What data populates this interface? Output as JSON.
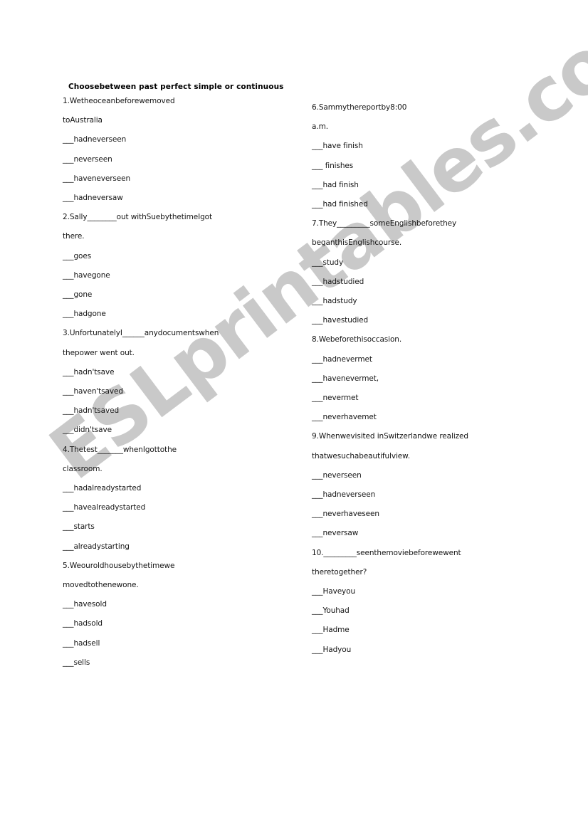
{
  "document": {
    "type": "esl-worksheet",
    "title": "Choosebetween past perfect simple or continuous",
    "watermark": "ESLprintables.com",
    "watermark_color": "#c9c9c9",
    "text_color": "#151515",
    "page_background": "#ffffff"
  },
  "left_column": [
    {
      "number": "1.",
      "stem_lines": [
        "1.Wetheoceanbeforewemoved",
        "toAustralia"
      ],
      "options": [
        "___hadneverseen",
        "___neverseen",
        "___haveneverseen",
        "___hadneversaw"
      ]
    },
    {
      "number": "2.",
      "stem_lines": [
        "2.Sally________out withSuebythetimeIgot",
        "there."
      ],
      "options": [
        "___goes",
        "___havegone",
        "___gone",
        "___hadgone"
      ]
    },
    {
      "number": "3.",
      "stem_lines": [
        "3.UnfortunatelyI______anydocumentswhen",
        "thepower went out."
      ],
      "options": [
        "___hadn'tsave",
        "___haven'tsaved",
        "___hadn'tsaved",
        "___didn'tsave"
      ]
    },
    {
      "number": "4.",
      "stem_lines": [
        "4.Thetest_______whenIgottothe",
        "classroom."
      ],
      "options": [
        "___hadalreadystarted",
        "___havealreadystarted",
        "___starts",
        "___alreadystarting"
      ]
    },
    {
      "number": "5.",
      "stem_lines": [
        "5.Weouroldhousebythetimewe",
        "movedtothenewone."
      ],
      "options": [
        "___havesold",
        "___hadsold",
        "___hadsell",
        "___sells"
      ]
    }
  ],
  "right_column": [
    {
      "number": "6.",
      "stem_lines": [
        "6.Sammythereportby8:00",
        "a.m."
      ],
      "options": [
        "___have finish",
        "___ finishes",
        "___had finish",
        "___had finished"
      ]
    },
    {
      "number": "7.",
      "stem_lines": [
        "7.They_________someEnglishbeforethey",
        "beganthisEnglishcourse."
      ],
      "options": [
        "___study",
        "___hadstudied",
        "___hadstudy",
        "___havestudied"
      ]
    },
    {
      "number": "8.",
      "stem_lines": [
        "8.Webeforethisoccasion."
      ],
      "options": [
        "___hadnevermet",
        "___havenevermet,",
        "___nevermet",
        "___neverhavemet"
      ]
    },
    {
      "number": "9.",
      "stem_lines": [
        "9.Whenwevisited inSwitzerlandwe realized",
        "thatwesuchabeautifulview."
      ],
      "options": [
        "___neverseen",
        "___hadneverseen",
        "___neverhaveseen",
        "___neversaw"
      ]
    },
    {
      "number": "10.",
      "stem_lines": [
        "10._________seenthemoviebeforewewent",
        "theretogether?"
      ],
      "options": [
        "___Haveyou",
        "___Youhad",
        "___Hadme",
        "___Hadyou"
      ]
    }
  ]
}
